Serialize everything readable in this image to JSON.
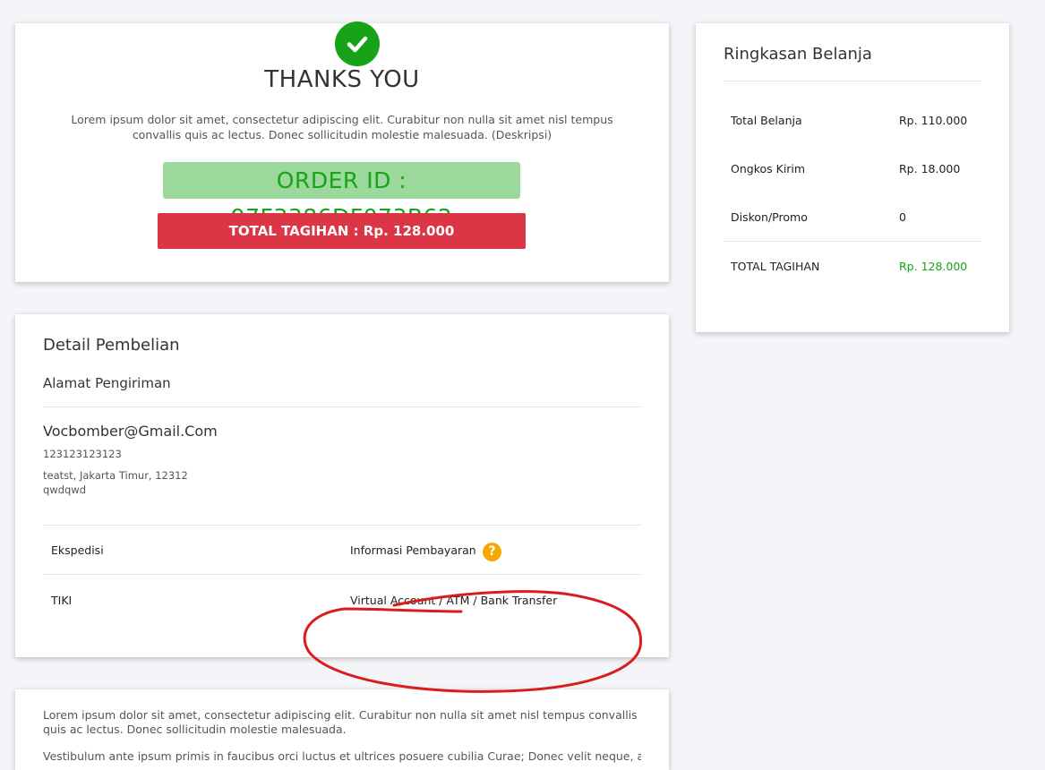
{
  "thanks": {
    "title": "THANKS YOU",
    "description": "Lorem ipsum dolor sit amet, consectetur adipiscing elit. Curabitur non nulla sit amet nisl tempus convallis quis ac lectus. Donec sollicitudin molestie malesuada. (Deskripsi)",
    "order_id": "ORDER ID : 97F3386DF073B62",
    "total_bill": "TOTAL TAGIHAN : Rp. 128.000",
    "icon": "check-circle-icon"
  },
  "summary": {
    "title": "Ringkasan Belanja",
    "rows": [
      {
        "label": "Total Belanja",
        "value": "Rp. 110.000"
      },
      {
        "label": "Ongkos Kirim",
        "value": "Rp. 18.000"
      },
      {
        "label": "Diskon/Promo",
        "value": "0"
      },
      {
        "label": "TOTAL TAGIHAN",
        "value": "Rp. 128.000"
      }
    ]
  },
  "detail": {
    "title": "Detail Pembelian",
    "address_title": "Alamat Pengiriman",
    "email": "Vocbomber@Gmail.Com",
    "phone": "123123123123",
    "address_line1": "teatst, Jakarta Timur, 12312",
    "address_line2": "qwdqwd",
    "expedition_header": "Ekspedisi",
    "payment_header": "Informasi Pembayaran",
    "expedition_value": "TIKI",
    "payment_value": "Virtual Account / ATM / Bank Transfer",
    "help_icon": "?"
  },
  "bottom": {
    "text": "Lorem ipsum dolor sit amet, consectetur adipiscing elit. Curabitur non nulla sit amet nisl tempus convallis quis ac lectus. Donec sollicitudin molestie malesuada.",
    "text2": "Vestibulum ante ipsum primis in faucibus orci luctus et ultrices posuere cubilia Curae; Donec velit neque, auctor"
  },
  "colors": {
    "success": "#17a317",
    "danger": "#dc3545",
    "warning": "#f5a800",
    "annotation": "#d91c1c"
  }
}
